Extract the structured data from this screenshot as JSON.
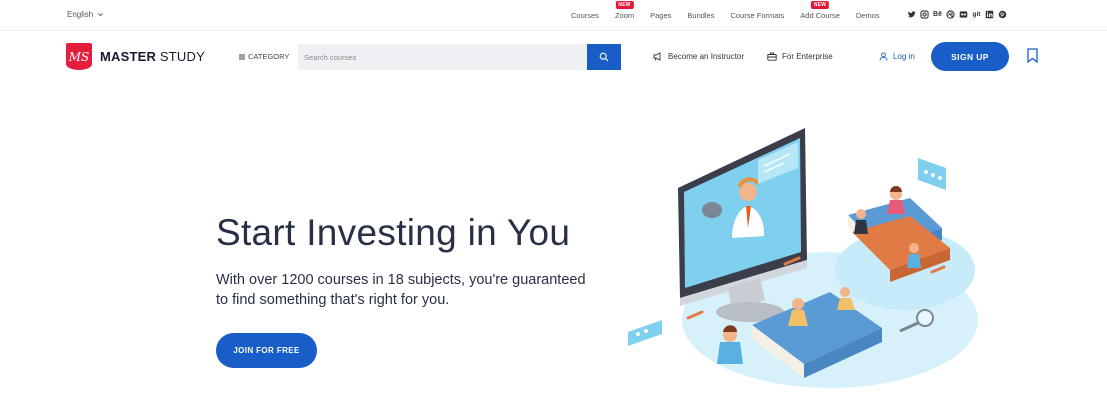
{
  "topbar": {
    "language": "English",
    "links": [
      {
        "label": "Courses",
        "badge": ""
      },
      {
        "label": "Zoom",
        "badge": "NEW"
      },
      {
        "label": "Pages",
        "badge": ""
      },
      {
        "label": "Bundles",
        "badge": ""
      },
      {
        "label": "Course Formats",
        "badge": ""
      },
      {
        "label": "Add Course",
        "badge": "NEW"
      },
      {
        "label": "Demos",
        "badge": ""
      }
    ],
    "social": [
      "twitter-icon",
      "instagram-icon",
      "behance-icon",
      "dribbble-icon",
      "flickr-icon",
      "git-icon",
      "linkedin-icon",
      "pinterest-icon"
    ]
  },
  "header": {
    "logo_initials": "MS",
    "logo_text_bold": "MASTER",
    "logo_text_light": "STUDY",
    "category_label": "CATEGORY",
    "search_placeholder": "Search courses",
    "become_instructor": "Become an Instructor",
    "for_enterprise": "For Enterprise",
    "login": "Log in",
    "signup": "SIGN UP"
  },
  "hero": {
    "title": "Start Investing in You",
    "subtitle": "With over 1200 courses in 18 subjects, you're guaranteed to find something that's right for you.",
    "cta": "JOIN FOR FREE"
  },
  "colors": {
    "primary": "#195ec8",
    "brand_red": "#e41e3d",
    "badge_red": "#e8173a",
    "illustration_light": "#d7f1fb",
    "illustration_blue": "#5b9bd5"
  }
}
